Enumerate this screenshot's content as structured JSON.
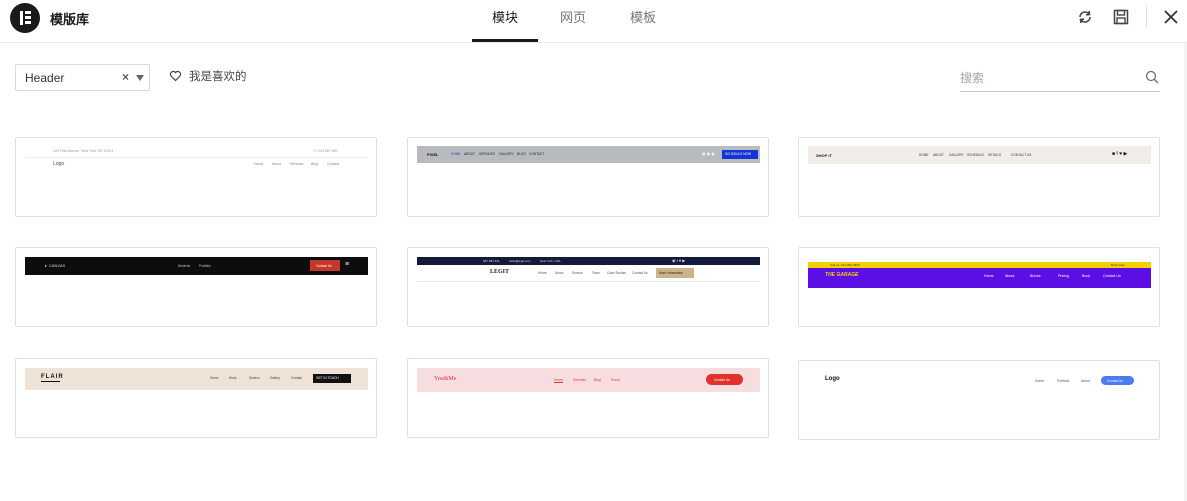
{
  "app": {
    "title": "模版库"
  },
  "tabs": [
    {
      "label": "模块"
    },
    {
      "label": "网页"
    },
    {
      "label": "模板"
    }
  ],
  "header_icons": [
    "sync-icon",
    "save-icon",
    "close-icon"
  ],
  "filter": {
    "selected": "Header",
    "favorites_label": "我是喜欢的"
  },
  "search": {
    "placeholder": "搜索"
  },
  "colors": {
    "accent": "#1a1a1a",
    "card_border": "#dfe2e5",
    "preview2_bg": "#b8bbbe",
    "preview4_bg": "#0d0d0d",
    "preview4_button": "#c4382b",
    "preview5_topbar": "#141a3a",
    "preview5_button": "#cdb38c",
    "preview6_topbar": "#f5d000",
    "preview6_bg": "#5b0fe5",
    "preview7_bg": "#efe3d8",
    "preview8_bg": "#f8dde0",
    "preview8_button": "#e0322b",
    "preview9_button": "#4a7cf0"
  },
  "templates": [
    {
      "topline": "123 Fifth Avenue, New York, NY 10001",
      "phone": "+1 234 567 890",
      "logo": "Logo",
      "nav": [
        "Home",
        "About",
        "Services",
        "Blog",
        "Contact"
      ]
    },
    {
      "logo": "PIXEL",
      "nav": [
        "HOME",
        "ABOUT",
        "SERVICES",
        "GALLERY",
        "BLOG",
        "CONTACT"
      ],
      "button": "SCHEDULE NOW"
    },
    {
      "logo": "SHOP IT",
      "nav": [
        "HOME",
        "ABOUT",
        "GALLERY",
        "SCHEDULE",
        "DETAILS",
        "CONTACT US"
      ]
    },
    {
      "logo": "CANVAS",
      "nav": [
        "Services",
        "Portfolio"
      ],
      "button": "Contact Us"
    },
    {
      "topline": [
        "987 654 321",
        "hello@legit.com",
        "New York, USA"
      ],
      "logo": "LEGIT",
      "nav": [
        "Home",
        "About",
        "Service",
        "Team",
        "Case Studies",
        "Contact Us"
      ],
      "button": "More Information"
    },
    {
      "topline": "Call us: 123-456-7890",
      "topright": "Book Now",
      "logo": "THE GARAGE",
      "nav": [
        "Home",
        "About",
        "Blocks",
        "Pricing",
        "Book",
        "Contact Us"
      ]
    },
    {
      "logo": "FLAIR",
      "nav": [
        "Home",
        "Work",
        "Service",
        "Gallery",
        "Contact"
      ],
      "button": "GET IN TOUCH"
    },
    {
      "logo": "You&Me",
      "nav": [
        "Home",
        "Services",
        "Blog",
        "Event"
      ],
      "button": "Contact Us"
    },
    {
      "logo": "Logo",
      "nav": [
        "Home",
        "Portfolio",
        "About"
      ],
      "button": "Contact Us"
    }
  ]
}
